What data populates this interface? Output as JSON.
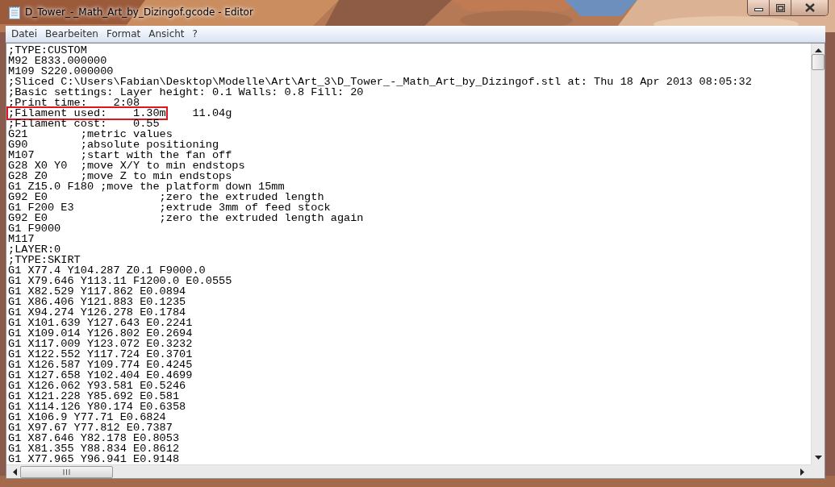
{
  "window": {
    "title": "D_Tower_-_Math_Art_by_Dizingof.gcode - Editor"
  },
  "menu": [
    "Datei",
    "Bearbeiten",
    "Format",
    "Ansicht",
    "?"
  ],
  "lines": [
    {
      "kind": "plain",
      "text": ";TYPE:CUSTOM"
    },
    {
      "kind": "plain",
      "text": "M92 E833.000000"
    },
    {
      "kind": "plain",
      "text": "M109 S220.000000"
    },
    {
      "kind": "plain",
      "text": ";Sliced C:\\Users\\Fabian\\Desktop\\Modelle\\Art\\Art_3\\D_Tower_-_Math_Art_by_Dizingof.stl at: Thu 18 Apr 2013 08:05:32"
    },
    {
      "kind": "plain",
      "text": ";Basic settings: Layer height: 0.1 Walls: 0.8 Fill: 20"
    },
    {
      "kind": "plain",
      "text": ";Print time:    2:08"
    },
    {
      "kind": "marked",
      "text": ";Filament used:    1.30m",
      "rest": "    11.04g"
    },
    {
      "kind": "plain",
      "text": ";Filament cost:    0.55"
    },
    {
      "kind": "plain",
      "text": "G21        ;metric values"
    },
    {
      "kind": "plain",
      "text": "G90        ;absolute positioning"
    },
    {
      "kind": "plain",
      "text": "M107       ;start with the fan off"
    },
    {
      "kind": "plain",
      "text": "G28 X0 Y0  ;move X/Y to min endstops"
    },
    {
      "kind": "plain",
      "text": "G28 Z0     ;move Z to min endstops"
    },
    {
      "kind": "plain",
      "text": "G1 Z15.0 F180 ;move the platform down 15mm"
    },
    {
      "kind": "plain",
      "text": "G92 E0                 ;zero the extruded length"
    },
    {
      "kind": "plain",
      "text": "G1 F200 E3             ;extrude 3mm of feed stock"
    },
    {
      "kind": "plain",
      "text": "G92 E0                 ;zero the extruded length again"
    },
    {
      "kind": "plain",
      "text": "G1 F9000"
    },
    {
      "kind": "plain",
      "text": "M117"
    },
    {
      "kind": "plain",
      "text": ";LAYER:0"
    },
    {
      "kind": "plain",
      "text": ";TYPE:SKIRT"
    },
    {
      "kind": "plain",
      "text": "G1 X77.4 Y104.287 Z0.1 F9000.0"
    },
    {
      "kind": "plain",
      "text": "G1 X79.646 Y113.11 F1200.0 E0.0555"
    },
    {
      "kind": "plain",
      "text": "G1 X82.529 Y117.862 E0.0894"
    },
    {
      "kind": "plain",
      "text": "G1 X86.406 Y121.883 E0.1235"
    },
    {
      "kind": "plain",
      "text": "G1 X94.274 Y126.278 E0.1784"
    },
    {
      "kind": "plain",
      "text": "G1 X101.639 Y127.643 E0.2241"
    },
    {
      "kind": "plain",
      "text": "G1 X109.014 Y126.802 E0.2694"
    },
    {
      "kind": "plain",
      "text": "G1 X117.009 Y123.072 E0.3232"
    },
    {
      "kind": "plain",
      "text": "G1 X122.552 Y117.724 E0.3701"
    },
    {
      "kind": "plain",
      "text": "G1 X126.587 Y109.774 E0.4245"
    },
    {
      "kind": "plain",
      "text": "G1 X127.658 Y102.404 E0.4699"
    },
    {
      "kind": "plain",
      "text": "G1 X126.062 Y93.581 E0.5246"
    },
    {
      "kind": "plain",
      "text": "G1 X121.228 Y85.692 E0.581"
    },
    {
      "kind": "plain",
      "text": "G1 X114.126 Y80.174 E0.6358"
    },
    {
      "kind": "plain",
      "text": "G1 X106.9 Y77.71 E0.6824"
    },
    {
      "kind": "plain",
      "text": "G1 X97.67 Y77.812 E0.7387"
    },
    {
      "kind": "plain",
      "text": "G1 X87.646 Y82.178 E0.8053"
    },
    {
      "kind": "plain",
      "text": "G1 X81.355 Y88.834 E0.8612"
    },
    {
      "kind": "plain",
      "text": "G1 X77.965 Y96.941 E0.9148"
    }
  ]
}
